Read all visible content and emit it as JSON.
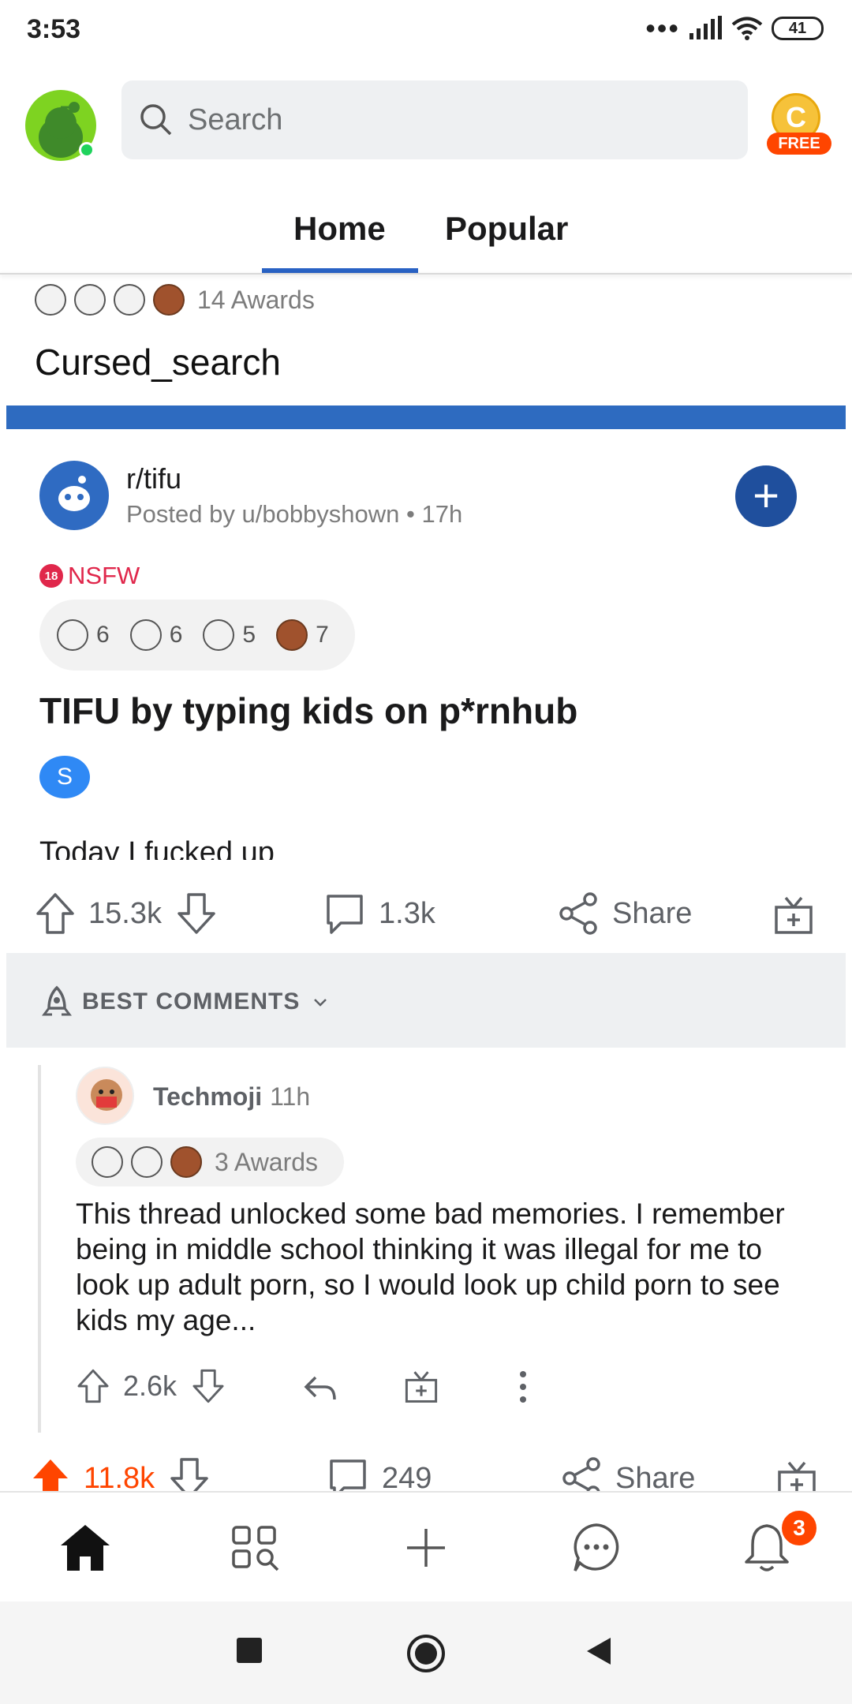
{
  "status_bar": {
    "time": "3:53",
    "battery": "41"
  },
  "header": {
    "search_placeholder": "Search",
    "coin_label": "FREE",
    "coin_symbol": "C"
  },
  "tabs": [
    {
      "label": "Home"
    },
    {
      "label": "Popular"
    }
  ],
  "previous_post": {
    "awards_text": "14 Awards",
    "title": "Cursed_search"
  },
  "post": {
    "subreddit": "r/tifu",
    "posted_by": "Posted by u/bobbyshown • 17h",
    "nsfw_label": "NSFW",
    "nsfw_badge": "18",
    "award_counts": [
      "6",
      "6",
      "5",
      "7"
    ],
    "title": "TIFU by typing kids on p*rnhub",
    "flair": "S",
    "body_preview": "Today I fucked up",
    "upvotes": "15.3k",
    "comments": "1.3k",
    "share_label": "Share"
  },
  "comments_section": {
    "sort_label": "BEST COMMENTS"
  },
  "comment": {
    "author": "Techmoji",
    "time": "11h",
    "awards_text": "3 Awards",
    "body": "This thread unlocked some bad memories. I remember being in middle school thinking it was illegal for me to look up adult porn, so I would look up child porn to see kids my age...",
    "upvotes": "2.6k"
  },
  "next_post": {
    "upvotes": "11.8k",
    "comments": "249",
    "share_label": "Share"
  },
  "bottom_nav": {
    "notification_count": "3"
  },
  "colors": {
    "accent": "#2962c4",
    "orange": "#ff4500",
    "nsfw": "#e0274b"
  }
}
